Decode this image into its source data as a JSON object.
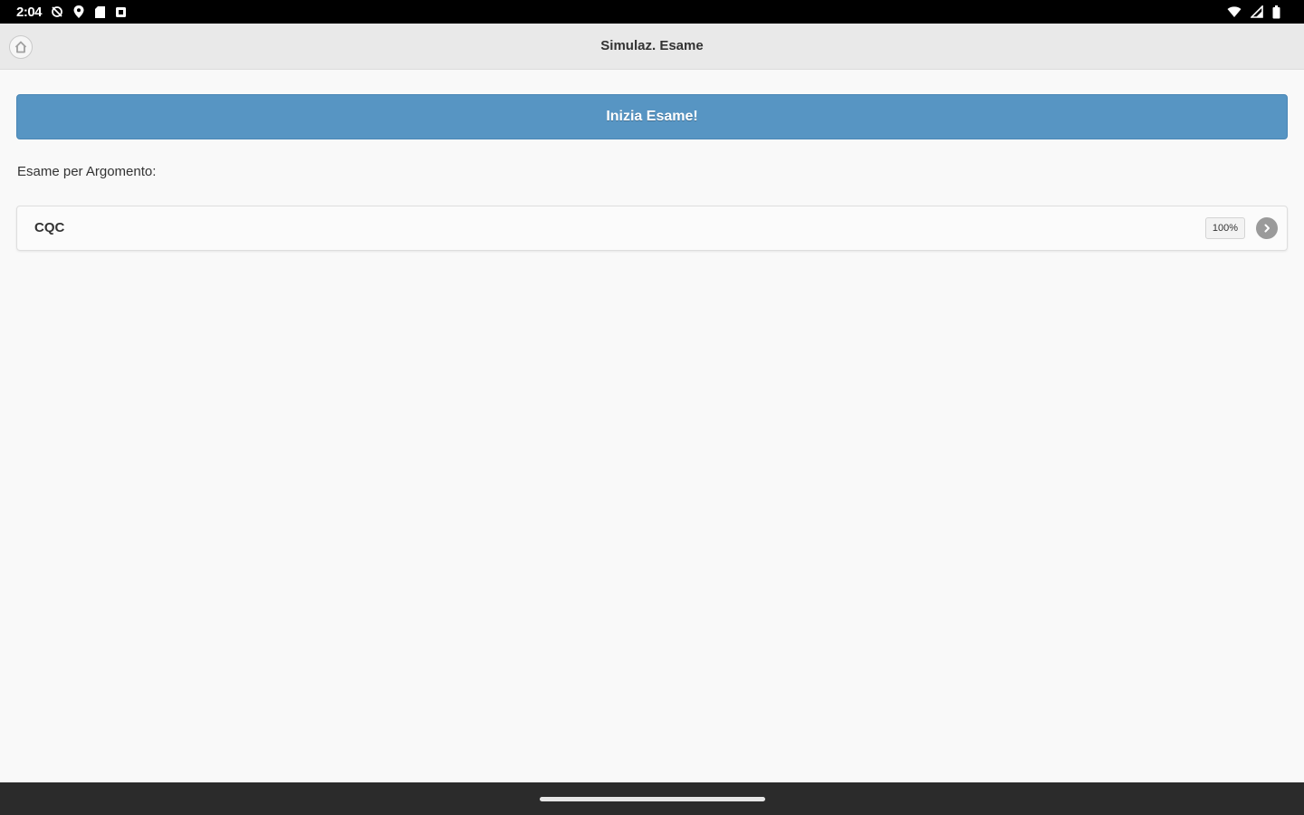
{
  "status_bar": {
    "time": "2:04",
    "left_icons": [
      "sync-off-icon",
      "location-icon",
      "sd-card-icon",
      "notification-icon"
    ],
    "right_icons": [
      "wifi-icon",
      "signal-icon",
      "battery-icon"
    ]
  },
  "header": {
    "title": "Simulaz. Esame",
    "home_icon": "home-icon"
  },
  "main": {
    "start_button_label": "Inizia Esame!",
    "section_label": "Esame per Argomento:",
    "topics": [
      {
        "label": "CQC",
        "count": "100%",
        "icon": "chevron-right-icon"
      }
    ]
  },
  "colors": {
    "accent": "#5795c3",
    "header_bg": "#e9e9e9",
    "page_bg": "#f9f9f9"
  }
}
